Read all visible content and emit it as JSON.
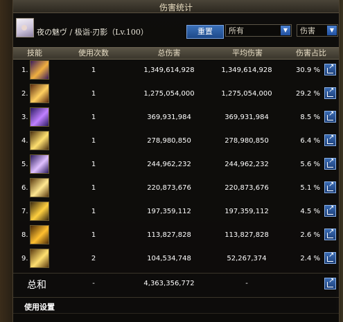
{
  "window": {
    "title": "伤害统计"
  },
  "header": {
    "character": "夜の魅ヴ / 极诣·刃影（Lv.100）",
    "reset_button": "重置",
    "filter_select": "所有",
    "type_select": "伤害"
  },
  "table": {
    "columns": [
      "技能",
      "使用次数",
      "总伤害",
      "平均伤害",
      "伤害占比"
    ],
    "rows": [
      {
        "rank": "1.",
        "uses": "1",
        "total": "1,349,614,928",
        "avg": "1,349,614,928",
        "pct": "30.9 %",
        "icon": "skill-icon-1",
        "colors": [
          "#3a1a5a",
          "#f0b040"
        ]
      },
      {
        "rank": "2.",
        "uses": "1",
        "total": "1,275,054,000",
        "avg": "1,275,054,000",
        "pct": "29.2 %",
        "icon": "skill-icon-2",
        "colors": [
          "#5a2a10",
          "#ffd060"
        ]
      },
      {
        "rank": "3.",
        "uses": "1",
        "total": "369,931,984",
        "avg": "369,931,984",
        "pct": "8.5 %",
        "icon": "skill-icon-3",
        "colors": [
          "#2a1a60",
          "#c080ff"
        ]
      },
      {
        "rank": "4.",
        "uses": "1",
        "total": "278,980,850",
        "avg": "278,980,850",
        "pct": "6.4 %",
        "icon": "skill-icon-4",
        "colors": [
          "#4a3010",
          "#ffe070"
        ]
      },
      {
        "rank": "5.",
        "uses": "1",
        "total": "244,962,232",
        "avg": "244,962,232",
        "pct": "5.6 %",
        "icon": "skill-icon-5",
        "colors": [
          "#2a1a5a",
          "#e0c0ff"
        ]
      },
      {
        "rank": "6.",
        "uses": "1",
        "total": "220,873,676",
        "avg": "220,873,676",
        "pct": "5.1 %",
        "icon": "skill-icon-6",
        "colors": [
          "#5a3a10",
          "#ffe890"
        ]
      },
      {
        "rank": "7.",
        "uses": "1",
        "total": "197,359,112",
        "avg": "197,359,112",
        "pct": "4.5 %",
        "icon": "skill-icon-7",
        "colors": [
          "#3a2a10",
          "#ffd040"
        ]
      },
      {
        "rank": "8.",
        "uses": "1",
        "total": "113,827,828",
        "avg": "113,827,828",
        "pct": "2.6 %",
        "icon": "skill-icon-8",
        "colors": [
          "#4a2a08",
          "#ffc030"
        ]
      },
      {
        "rank": "9.",
        "uses": "2",
        "total": "104,534,748",
        "avg": "52,267,374",
        "pct": "2.4 %",
        "icon": "skill-icon-9",
        "colors": [
          "#5a3a10",
          "#ffe070"
        ]
      }
    ]
  },
  "summary": {
    "label": "总和",
    "uses": "-",
    "total": "4,363,356,772",
    "avg": "-"
  },
  "footer": {
    "settings_label": "使用设置"
  }
}
